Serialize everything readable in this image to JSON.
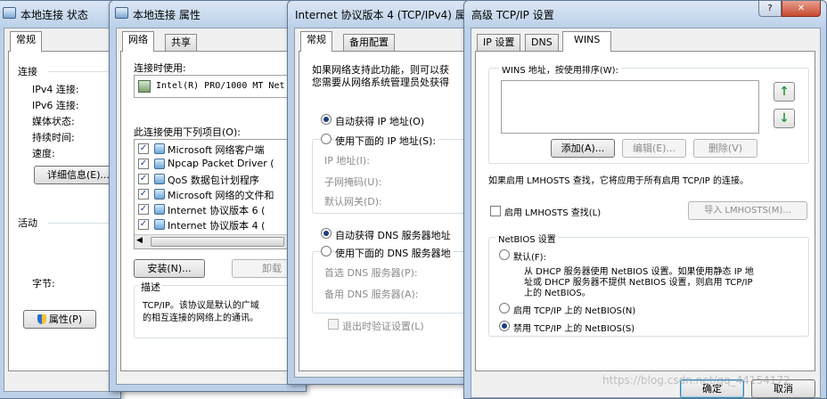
{
  "status_window": {
    "title": "本地连接 状态",
    "tab": "常规",
    "connection_label": "连接",
    "rows": [
      "IPv4 连接:",
      "IPv6 连接:",
      "媒体状态:",
      "持续时间:",
      "速度:"
    ],
    "details_button": "详细信息(E)...",
    "activity_label": "活动",
    "bytes_label": "字节:",
    "properties_button": "属性(P)"
  },
  "props_window": {
    "title": "本地连接 属性",
    "tabs": [
      "网络",
      "共享"
    ],
    "connect_using_label": "连接时使用:",
    "adapter_name": "Intel(R) PRO/1000 MT Net",
    "items_label": "此连接使用下列项目(O):",
    "items": [
      "Microsoft 网络客户端",
      "Npcap Packet Driver (",
      "QoS 数据包计划程序",
      "Microsoft 网络的文件和",
      "Internet 协议版本 6 (",
      "Internet 协议版本 4 ("
    ],
    "install_button": "安装(N)...",
    "uninstall_button": "卸载",
    "description_label": "描述",
    "description_text": [
      "TCP/IP。该协议是默认的广域",
      "的相互连接的网络上的通讯。"
    ]
  },
  "ipv4_window": {
    "title": "Internet 协议版本 4 (TCP/IPv4) 属",
    "tabs": [
      "常规",
      "备用配置"
    ],
    "intro_text": [
      "如果网络支持此功能，则可以获",
      "您需要从网络系统管理员处获得"
    ],
    "ip_auto": "自动获得 IP 地址(O)",
    "ip_manual": "使用下面的 IP 地址(S):",
    "ip_address_label": "IP 地址(I):",
    "subnet_label": "子网掩码(U):",
    "gateway_label": "默认网关(D):",
    "dns_auto": "自动获得 DNS 服务器地址",
    "dns_manual": "使用下面的 DNS 服务器地",
    "preferred_dns_label": "首选 DNS 服务器(P):",
    "alternate_dns_label": "备用 DNS 服务器(A):",
    "validate_label": "退出时验证设置(L)"
  },
  "advanced_window": {
    "title": "高级 TCP/IP 设置",
    "help_button": "?",
    "close_button": "✕",
    "tabs": [
      "IP 设置",
      "DNS",
      "WINS"
    ],
    "wins_label": "WINS 地址，按使用排序(W):",
    "up_arrow": "↑",
    "down_arrow": "↓",
    "add_button": "添加(A)...",
    "edit_button": "编辑(E)...",
    "delete_button": "删除(V)",
    "lmhosts_info": "如果启用 LMHOSTS 查找，它将应用于所有启用 TCP/IP 的连接。",
    "lmhosts_check_label": "启用 LMHOSTS 查找(L)",
    "import_button": "导入 LMHOSTS(M)...",
    "netbios_group_label": "NetBIOS 设置",
    "netbios_default": "默认(F):",
    "netbios_default_desc": [
      "从 DHCP 服务器使用 NetBIOS 设置。如果使用静态 IP 地",
      "址或 DHCP 服务器不提供 NetBIOS 设置，则启用 TCP/IP",
      "上的 NetBIOS。"
    ],
    "netbios_enable": "启用 TCP/IP 上的 NetBIOS(N)",
    "netbios_disable": "禁用 TCP/IP 上的 NetBIOS(S)",
    "ok_button": "确定",
    "cancel_button": "取消"
  },
  "watermark": "https://blog.csdn.net/qq_44154172"
}
